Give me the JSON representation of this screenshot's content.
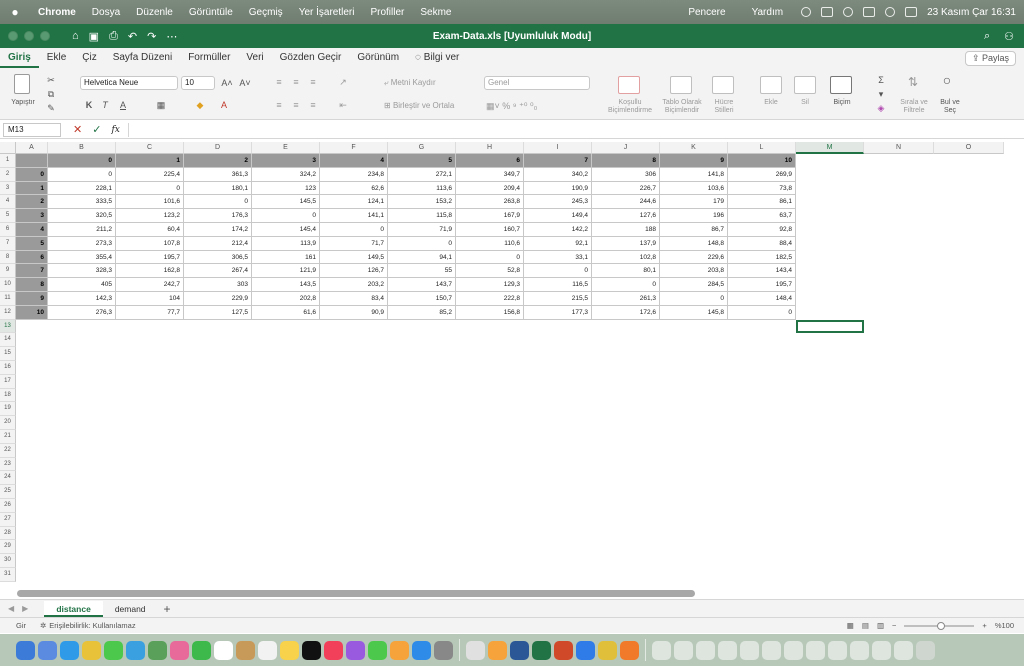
{
  "menubar": {
    "app": "Chrome",
    "items": [
      "Dosya",
      "Düzenle",
      "Görüntüle",
      "Geçmiş",
      "Yer İşaretleri",
      "Profiller",
      "Sekme"
    ],
    "right_items": [
      "Pencere",
      "Yardım"
    ],
    "datetime": "23 Kasım Çar  16:31"
  },
  "window": {
    "title": "Exam-Data.xls  [Uyumluluk Modu]"
  },
  "ribbon_tabs": [
    "Giriş",
    "Ekle",
    "Çiz",
    "Sayfa Düzeni",
    "Formüller",
    "Veri",
    "Gözden Geçir",
    "Görünüm"
  ],
  "tell_me": "Bilgi ver",
  "share_label": "Paylaş",
  "ribbon": {
    "paste_label": "Yapıştır",
    "font_name": "Helvetica Neue",
    "font_size": "10",
    "wrap_text": "Metni Kaydır",
    "merge_center": "Birleştir ve Ortala",
    "number_format": "Genel",
    "conditional": "Koşullu Biçimlendirme",
    "format_table": "Tablo Olarak Biçimlendir",
    "cell_styles": "Hücre Stilleri",
    "insert": "Ekle",
    "delete": "Sil",
    "format": "Biçim",
    "sort_filter": "Sırala ve Filtrele",
    "find_select": "Bul ve Seç",
    "bold": "K",
    "italic": "T",
    "underline": "A"
  },
  "formula_bar": {
    "name_box": "M13",
    "formula": ""
  },
  "columns": [
    "A",
    "B",
    "C",
    "D",
    "E",
    "F",
    "G",
    "H",
    "I",
    "J",
    "K",
    "L",
    "M",
    "N",
    "O"
  ],
  "selected_column": "M",
  "selected_row": 13,
  "header_row": [
    "0",
    "1",
    "2",
    "3",
    "4",
    "5",
    "6",
    "7",
    "8",
    "9",
    "10"
  ],
  "table_rows": [
    {
      "label": "0",
      "values": [
        "0",
        "225,4",
        "361,3",
        "324,2",
        "234,8",
        "272,1",
        "349,7",
        "340,2",
        "306",
        "141,8",
        "269,9"
      ]
    },
    {
      "label": "1",
      "values": [
        "228,1",
        "0",
        "180,1",
        "123",
        "62,6",
        "113,6",
        "209,4",
        "190,9",
        "226,7",
        "103,6",
        "73,8"
      ]
    },
    {
      "label": "2",
      "values": [
        "333,5",
        "101,6",
        "0",
        "145,5",
        "124,1",
        "153,2",
        "263,8",
        "245,3",
        "244,6",
        "179",
        "86,1"
      ]
    },
    {
      "label": "3",
      "values": [
        "320,5",
        "123,2",
        "176,3",
        "0",
        "141,1",
        "115,8",
        "167,9",
        "149,4",
        "127,6",
        "196",
        "63,7"
      ]
    },
    {
      "label": "4",
      "values": [
        "211,2",
        "60,4",
        "174,2",
        "145,4",
        "0",
        "71,9",
        "160,7",
        "142,2",
        "188",
        "86,7",
        "92,8"
      ]
    },
    {
      "label": "5",
      "values": [
        "273,3",
        "107,8",
        "212,4",
        "113,9",
        "71,7",
        "0",
        "110,6",
        "92,1",
        "137,9",
        "148,8",
        "88,4"
      ]
    },
    {
      "label": "6",
      "values": [
        "355,4",
        "195,7",
        "306,5",
        "161",
        "149,5",
        "94,1",
        "0",
        "33,1",
        "102,8",
        "229,6",
        "182,5"
      ]
    },
    {
      "label": "7",
      "values": [
        "328,3",
        "162,8",
        "267,4",
        "121,9",
        "126,7",
        "55",
        "52,8",
        "0",
        "80,1",
        "203,8",
        "143,4"
      ]
    },
    {
      "label": "8",
      "values": [
        "405",
        "242,7",
        "303",
        "143,5",
        "203,2",
        "143,7",
        "129,3",
        "116,5",
        "0",
        "284,5",
        "195,7"
      ]
    },
    {
      "label": "9",
      "values": [
        "142,3",
        "104",
        "229,9",
        "202,8",
        "83,4",
        "150,7",
        "222,8",
        "215,5",
        "261,3",
        "0",
        "148,4"
      ]
    },
    {
      "label": "10",
      "values": [
        "276,3",
        "77,7",
        "127,5",
        "61,6",
        "90,9",
        "85,2",
        "156,8",
        "177,3",
        "172,6",
        "145,8",
        "0"
      ]
    }
  ],
  "row_numbers": [
    "1",
    "2",
    "3",
    "4",
    "5",
    "6",
    "7",
    "8",
    "9",
    "10",
    "11",
    "12",
    "13",
    "14",
    "15",
    "16",
    "17",
    "18",
    "19",
    "20",
    "21",
    "22",
    "23",
    "24",
    "25",
    "26",
    "27",
    "28",
    "29",
    "30",
    "31"
  ],
  "sheets": [
    "distance",
    "demand"
  ],
  "active_sheet": "distance",
  "status": {
    "mode": "Gir",
    "accessibility": "Erişilebilirlik: Kullanılamaz",
    "zoom": "%100"
  },
  "colors": {
    "excel_green": "#217346",
    "header_fill": "#9a9a9a"
  }
}
